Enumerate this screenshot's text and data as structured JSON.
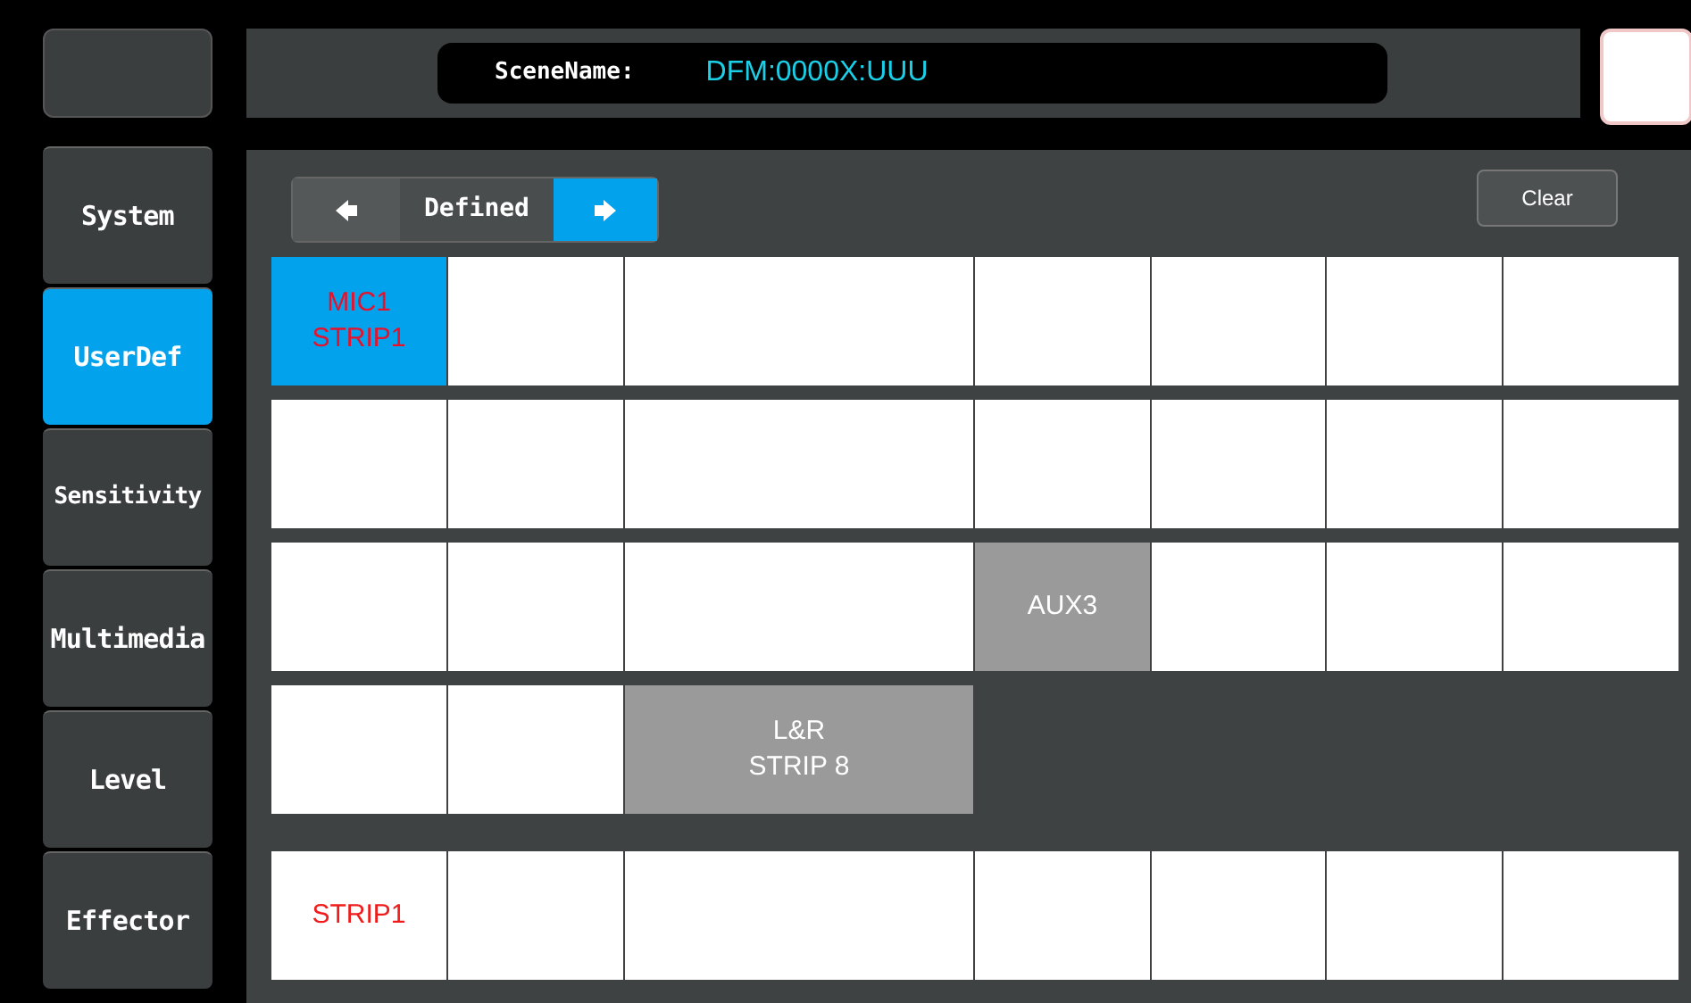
{
  "scene": {
    "label": "SceneName:",
    "value": "DFM:0000X:UUU"
  },
  "sidebar": {
    "items": [
      {
        "label": "System",
        "selected": false
      },
      {
        "label": "UserDef",
        "selected": true
      },
      {
        "label": "Sensitivity",
        "selected": false
      },
      {
        "label": "Multimedia",
        "selected": false
      },
      {
        "label": "Level",
        "selected": false
      },
      {
        "label": "Effector",
        "selected": false
      }
    ]
  },
  "pager": {
    "label": "Defined",
    "prev_active": false,
    "next_active": true
  },
  "clear_button": "Clear",
  "grid": {
    "rows": [
      [
        {
          "kind": "active",
          "lines": [
            "MIC1",
            "STRIP1"
          ]
        },
        {
          "kind": "plain"
        },
        {
          "kind": "plain"
        },
        {
          "kind": "plain"
        },
        {
          "kind": "plain"
        },
        {
          "kind": "plain"
        },
        {
          "kind": "plain"
        }
      ],
      [
        {
          "kind": "plain"
        },
        {
          "kind": "plain"
        },
        {
          "kind": "plain"
        },
        {
          "kind": "plain"
        },
        {
          "kind": "plain"
        },
        {
          "kind": "plain"
        },
        {
          "kind": "plain"
        }
      ],
      [
        {
          "kind": "plain"
        },
        {
          "kind": "plain"
        },
        {
          "kind": "plain"
        },
        {
          "kind": "mapped",
          "lines": [
            "AUX3"
          ]
        },
        {
          "kind": "plain"
        },
        {
          "kind": "plain"
        },
        {
          "kind": "plain"
        }
      ],
      [
        {
          "kind": "plain"
        },
        {
          "kind": "plain"
        },
        {
          "kind": "mapped",
          "lines": [
            "L&R",
            "STRIP 8"
          ]
        }
      ],
      [
        {
          "kind": "plain",
          "lines": [
            "STRIP1"
          ]
        },
        {
          "kind": "plain"
        },
        {
          "kind": "plain"
        },
        {
          "kind": "plain"
        },
        {
          "kind": "plain"
        },
        {
          "kind": "plain"
        },
        {
          "kind": "plain"
        }
      ]
    ]
  }
}
